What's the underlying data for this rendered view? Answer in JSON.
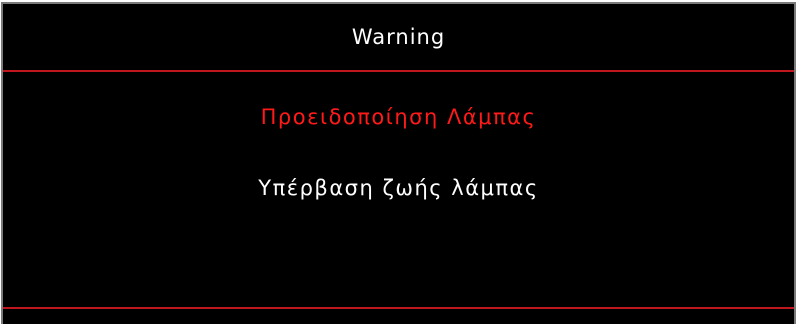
{
  "dialog": {
    "title": "Warning",
    "heading": "Προειδοποίηση Λάμπας",
    "message": "Υπέρβαση ζωής λάμπας"
  },
  "colors": {
    "background": "#000000",
    "frame": "#7a7a7a",
    "divider": "#c0161d",
    "heading_text": "#ff1a1a",
    "body_text": "#ffffff"
  }
}
